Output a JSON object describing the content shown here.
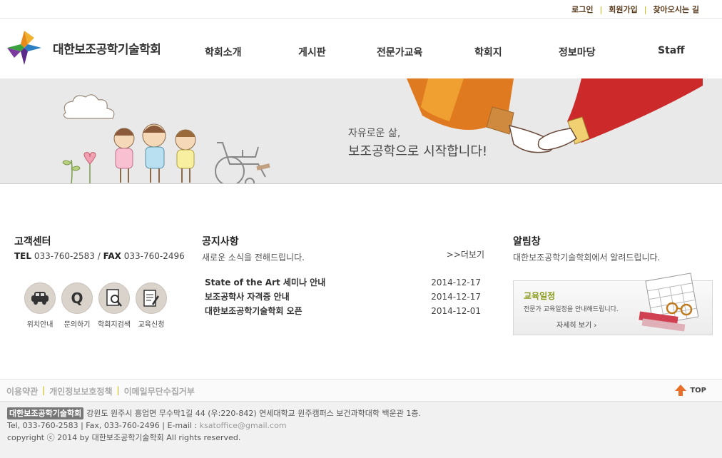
{
  "toplinks": [
    "로그인",
    "회원가입",
    "찾아오시는 길"
  ],
  "logo": {
    "text": "대한보조공학기술학회"
  },
  "gnb": [
    "학회소개",
    "게시판",
    "전문가교육",
    "학회지",
    "정보마당",
    "Staff"
  ],
  "banner": {
    "line1": "자유로운 삶,",
    "line2": "보조공학으로 시작합니다!"
  },
  "customer": {
    "title": "고객센터",
    "tel_label": "TEL",
    "tel": "033-760-2583",
    "fax_label": "FAX",
    "fax": "033-760-2496",
    "icons": [
      {
        "label": "위치안내",
        "icon": "car-icon"
      },
      {
        "label": "문의하기",
        "icon": "q-icon"
      },
      {
        "label": "학회지검색",
        "icon": "search-doc-icon"
      },
      {
        "label": "교육신청",
        "icon": "application-icon"
      }
    ]
  },
  "notice": {
    "title": "공지사항",
    "subtitle": "새로운 소식을 전해드립니다.",
    "more": ">>더보기",
    "items": [
      {
        "title": "State of the Art 세미나 안내",
        "date": "2014-12-17"
      },
      {
        "title": "보조공학사 자격증 안내",
        "date": "2014-12-17"
      },
      {
        "title": "대한보조공학기술학회 오픈",
        "date": "2014-12-01"
      }
    ]
  },
  "alert": {
    "title": "알림창",
    "subtitle": "대한보조공학기술학회에서 알려드립니다.",
    "card_title": "교육일정",
    "card_desc": "전문가 교육일정을 안내해드립니다.",
    "card_more": "자세히 보기"
  },
  "footer_links": [
    "이용약관",
    "개인정보보호정책",
    "이메일무단수집거부"
  ],
  "top_label": "TOP",
  "footer": {
    "badge": "대한보조공학기술학회",
    "address": "강원도 원주시 흥업면 무수막1길 44 (우:220-842) 연세대학교 원주캠퍼스 보건과학대학 백운관 1층.",
    "contact": "Tel, 033-760-2583 | Fax, 033-760-2496 | E-mail :",
    "email": "ksatoffice@gmail.com",
    "copyright": "copyright ⓒ 2014 by 대한보조공학기술학회 All rights reserved."
  },
  "colors": {
    "accent": "#8a9a1a",
    "top_arrow": "#e8702a",
    "banner_bg": "#e9e9e9"
  }
}
